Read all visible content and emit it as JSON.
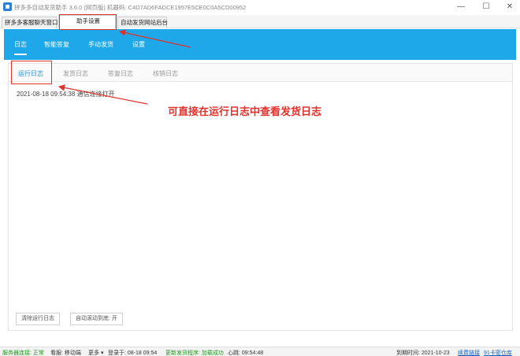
{
  "window": {
    "title": "拼多多自动发货助手 3.6.0 (网页版) 机器码: C4D7AD6FADCE1957E5CE0C0A5CD00952",
    "minimize_glyph": "—",
    "maximize_glyph": "☐",
    "close_glyph": "✕"
  },
  "top_tabs": [
    {
      "label": "拼多多客服聊天窗口"
    },
    {
      "label": "助手设置"
    },
    {
      "label": "自动发货网站后台"
    }
  ],
  "nav": {
    "items": [
      {
        "label": "日志"
      },
      {
        "label": "智能答复"
      },
      {
        "label": "手动发货"
      },
      {
        "label": "设置"
      }
    ]
  },
  "sub_tabs": [
    {
      "label": "运行日志"
    },
    {
      "label": "发货日志"
    },
    {
      "label": "答复日志"
    },
    {
      "label": "核销日志"
    }
  ],
  "log": {
    "line": "2021-08-18 09:54:38 通信连接打开"
  },
  "annotation": {
    "text": "可直接在运行日志中查看发货日志"
  },
  "buttons": {
    "clear_log": "清除运行日志",
    "auto_scroll": "自动滚动到底: 开"
  },
  "status": {
    "server_label": "服务器连接: 正常",
    "reply": "看服: 移动端",
    "more": "更多 ▾",
    "login": "登录于: 08-18 09:54",
    "update": "更新发货程序: 加载成功",
    "heartbeat": "心跳: 09:54:48",
    "expire": "到期时间: 2021-10-23",
    "renew": "续费链接",
    "card": "91卡密仓库"
  },
  "colors": {
    "accent": "#1ea8ea",
    "annotation_red": "#e0322d",
    "status_green": "#1a9b1a"
  }
}
